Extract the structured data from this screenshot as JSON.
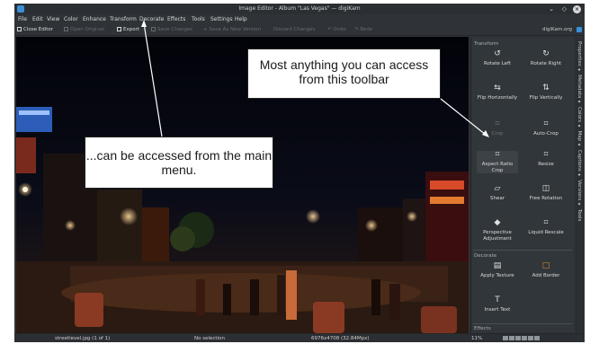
{
  "window": {
    "title": "Image Editor - Album \"Las Vegas\" — digiKam",
    "controls": {
      "chevron": "⌄",
      "diamond": "◇",
      "close": "×"
    }
  },
  "menubar": [
    "File",
    "Edit",
    "View",
    "Color",
    "Enhance",
    "Transform",
    "Decorate",
    "Effects",
    "Tools",
    "Settings",
    "Help"
  ],
  "toolbar": {
    "close_editor": "Close Editor",
    "open_original": "Open Original",
    "export": "Export",
    "save_changes": "Save Changes",
    "save_as_new_version": "Save As New Version",
    "discard_changes": "Discard Changes",
    "undo": "Undo",
    "redo": "Redo",
    "brand": "digiKam.org"
  },
  "callouts": {
    "toolbar": "Most anything you can access from this toolbar",
    "menu": "...can be accessed from the main menu."
  },
  "panel": {
    "transform_header": "Transform",
    "tools": {
      "rotate_left": "Rotate Left",
      "rotate_right": "Rotate Right",
      "flip_h": "Flip Horizontally",
      "flip_v": "Flip Vertically",
      "crop": "Crop",
      "auto_crop": "Auto-Crop",
      "aspect_ratio_crop": "Aspect Ratio Crop",
      "resize": "Resize",
      "shear": "Shear",
      "free_rotation": "Free Rotation",
      "perspective": "Perspective Adjustment",
      "liquid_rescale": "Liquid Rescale"
    },
    "decorate_header": "Decorate",
    "decorate_tools": {
      "apply_texture": "Apply Texture",
      "add_border": "Add Border",
      "insert_text": "Insert Text"
    },
    "effects_header": "Effects"
  },
  "tabstrip": "Properties ✦ Metadata ✦ Colors ✦ Map ✦ Captions ✦ Versions ✦ Tools",
  "status": {
    "filename": "streetlevel.jpg (1 of 1)",
    "selection": "No selection",
    "dimensions": "6976x4708 (32.84Mpx)",
    "zoom": "11%"
  },
  "icons": {
    "app_logo": "digikam-logo-icon",
    "rotate_left": "rotate-left-icon",
    "rotate_right": "rotate-right-icon"
  },
  "colors": {
    "accent": "#3a8fd8",
    "panel": "#31363a",
    "window": "#2f3337"
  }
}
